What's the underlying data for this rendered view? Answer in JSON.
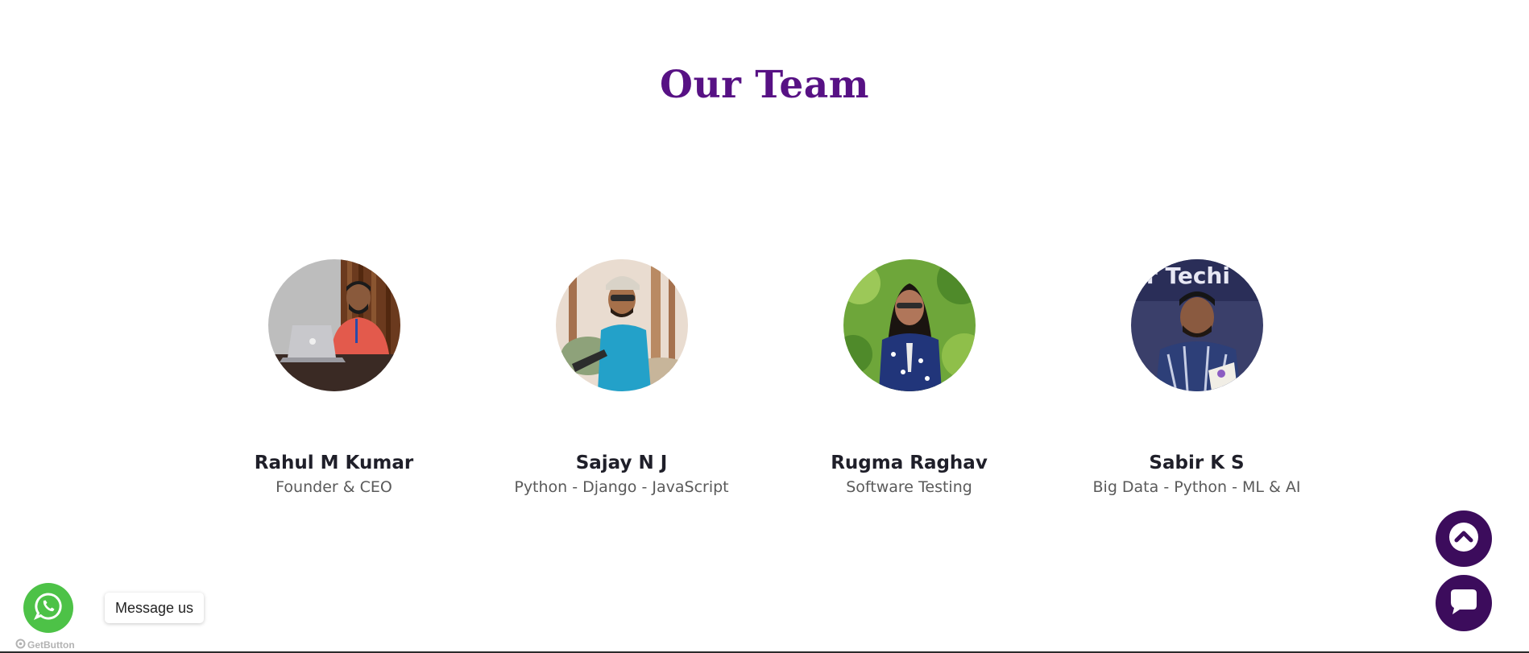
{
  "section": {
    "title": "Our Team"
  },
  "team": [
    {
      "name": "Rahul M Kumar",
      "role": "Founder & CEO"
    },
    {
      "name": "Sajay N J",
      "role": "Python - Django - JavaScript"
    },
    {
      "name": "Rugma Raghav",
      "role": "Software Testing"
    },
    {
      "name": "Sabir K S",
      "role": "Big Data - Python - ML & AI"
    }
  ],
  "widgets": {
    "whatsapp_label": "Message us",
    "credit_text": "GetButton",
    "scroll_top_icon": "chevron-up-icon",
    "chat_icon": "chat-bubble-icon",
    "whatsapp_icon": "whatsapp-icon"
  },
  "colors": {
    "title": "#571184",
    "button_bg": "#3c0c5c",
    "whatsapp_green": "#4dc247"
  }
}
